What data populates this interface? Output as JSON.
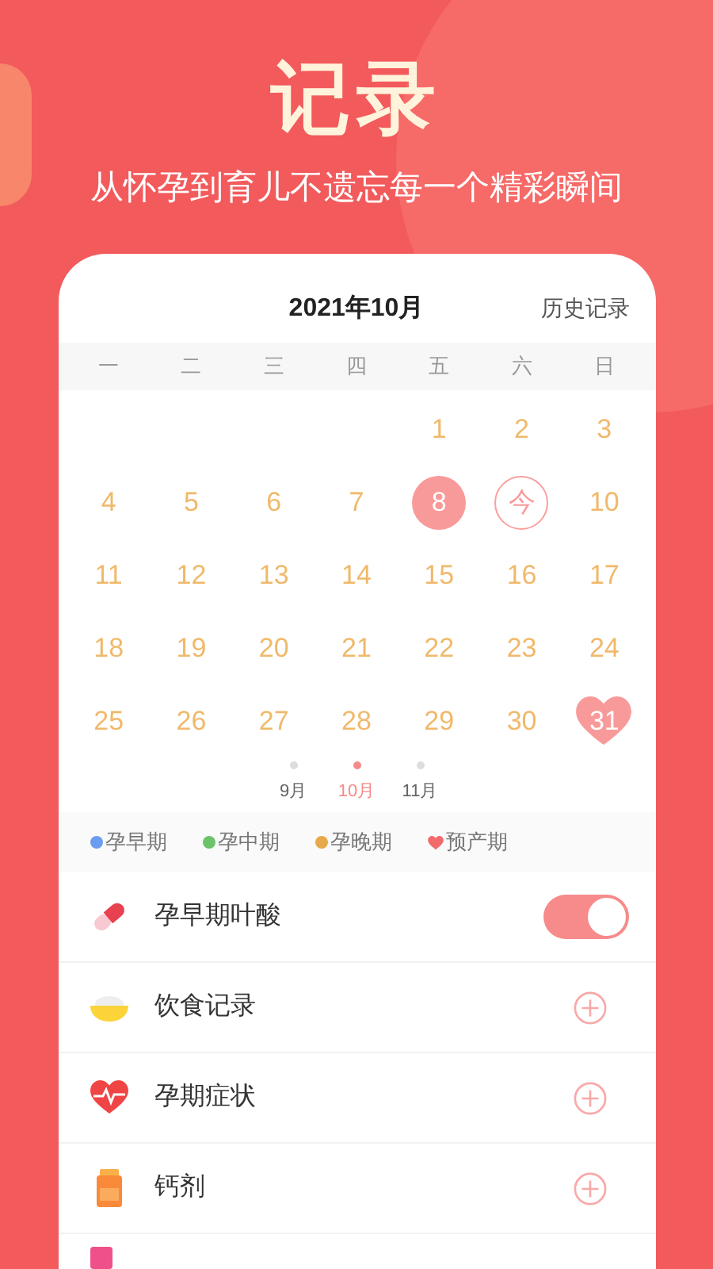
{
  "hero": {
    "title": "记录",
    "subtitle": "从怀孕到育儿不遗忘每一个精彩瞬间"
  },
  "calendar": {
    "title": "2021年10月",
    "history_link": "历史记录",
    "weekdays": [
      "一",
      "二",
      "三",
      "四",
      "五",
      "六",
      "日"
    ],
    "weeks": [
      [
        {
          "label": "1",
          "kind": "plain"
        },
        {
          "label": "2",
          "kind": "plain"
        },
        {
          "label": "3",
          "kind": "plain"
        }
      ],
      [
        {
          "label": "4",
          "kind": "plain"
        },
        {
          "label": "5",
          "kind": "plain"
        },
        {
          "label": "6",
          "kind": "plain"
        },
        {
          "label": "7",
          "kind": "plain"
        },
        {
          "label": "8",
          "kind": "selected"
        },
        {
          "label": "今",
          "kind": "today"
        },
        {
          "label": "10",
          "kind": "plain"
        }
      ],
      [
        {
          "label": "11",
          "kind": "plain"
        },
        {
          "label": "12",
          "kind": "plain"
        },
        {
          "label": "13",
          "kind": "plain"
        },
        {
          "label": "14",
          "kind": "plain"
        },
        {
          "label": "15",
          "kind": "plain"
        },
        {
          "label": "16",
          "kind": "plain"
        },
        {
          "label": "17",
          "kind": "plain"
        }
      ],
      [
        {
          "label": "18",
          "kind": "plain"
        },
        {
          "label": "19",
          "kind": "plain"
        },
        {
          "label": "20",
          "kind": "plain"
        },
        {
          "label": "21",
          "kind": "plain"
        },
        {
          "label": "22",
          "kind": "plain"
        },
        {
          "label": "23",
          "kind": "plain"
        },
        {
          "label": "24",
          "kind": "plain"
        }
      ],
      [
        {
          "label": "25",
          "kind": "plain"
        },
        {
          "label": "26",
          "kind": "plain"
        },
        {
          "label": "27",
          "kind": "plain"
        },
        {
          "label": "28",
          "kind": "plain"
        },
        {
          "label": "29",
          "kind": "plain"
        },
        {
          "label": "30",
          "kind": "plain"
        },
        {
          "label": "31",
          "kind": "due"
        }
      ]
    ],
    "months": [
      {
        "label": "9月",
        "selected": false
      },
      {
        "label": "10月",
        "selected": true
      },
      {
        "label": "11月",
        "selected": false
      }
    ],
    "legend": [
      {
        "label": "孕早期",
        "kind": "dot",
        "color": "#6b9cf0"
      },
      {
        "label": "孕中期",
        "kind": "dot",
        "color": "#6cc36a"
      },
      {
        "label": "孕晚期",
        "kind": "dot",
        "color": "#e8a94a"
      },
      {
        "label": "预产期",
        "kind": "heart",
        "color": "#f26b6b"
      }
    ]
  },
  "records": [
    {
      "label": "孕早期叶酸",
      "kind": "toggle",
      "on": true
    },
    {
      "label": "饮食记录",
      "kind": "add"
    },
    {
      "label": "孕期症状",
      "kind": "add"
    },
    {
      "label": "钙剂",
      "kind": "add"
    }
  ]
}
